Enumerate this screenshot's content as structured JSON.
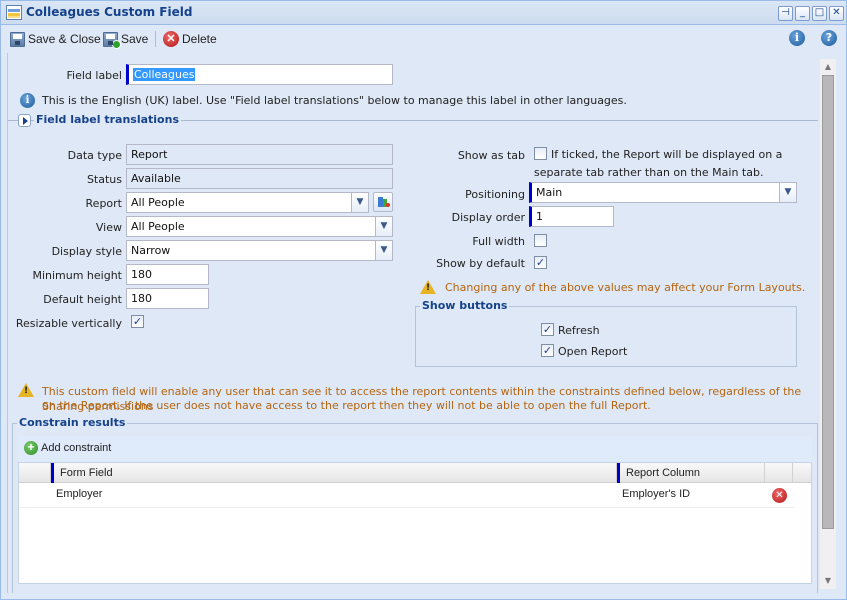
{
  "window": {
    "title": "Colleagues Custom Field",
    "controls": {
      "pin": "pin",
      "minimize": "minimize",
      "maximize": "maximize",
      "close": "close"
    }
  },
  "toolbar": {
    "save_close_label": "Save & Close",
    "save_label": "Save",
    "delete_label": "Delete"
  },
  "form": {
    "field_label": {
      "label": "Field label",
      "value": "Colleagues"
    },
    "info_note": "This is the English (UK) label. Use \"Field label translations\" below to manage this label in other languages.",
    "translations_title": "Field label translations",
    "data_type": {
      "label": "Data type",
      "value": "Report"
    },
    "status": {
      "label": "Status",
      "value": "Available"
    },
    "report": {
      "label": "Report",
      "value": "All People"
    },
    "view": {
      "label": "View",
      "value": "All People"
    },
    "display_style": {
      "label": "Display style",
      "value": "Narrow"
    },
    "min_height": {
      "label": "Minimum height",
      "value": "180"
    },
    "default_height": {
      "label": "Default height",
      "value": "180"
    },
    "resizable": {
      "label": "Resizable vertically",
      "checked": true
    },
    "show_as_tab": {
      "label": "Show as tab",
      "checked": false,
      "hint_line1": "If ticked, the Report will be displayed on a",
      "hint_line2": "separate tab rather than on the Main tab."
    },
    "positioning": {
      "label": "Positioning",
      "value": "Main"
    },
    "display_order": {
      "label": "Display order",
      "value": "1"
    },
    "full_width": {
      "label": "Full width",
      "checked": false
    },
    "show_by_default": {
      "label": "Show by default",
      "checked": true
    },
    "layout_warning": "Changing any of the above values may affect your Form Layouts.",
    "show_buttons": {
      "title": "Show buttons",
      "refresh": {
        "label": "Refresh",
        "checked": true
      },
      "open_report": {
        "label": "Open Report",
        "checked": true
      }
    },
    "access_warning_line1": "This custom field will enable any user that can see it to access the report contents within the constraints defined below, regardless of the Sharing permissions",
    "access_warning_line2": "on the Report. If the user does not have access to the report then they will not be able to open the full Report."
  },
  "constraints": {
    "title": "Constrain results",
    "add_label": "Add constraint",
    "columns": [
      "Form Field",
      "Report Column"
    ],
    "rows": [
      {
        "form_field": "Employer",
        "report_column": "Employer's ID"
      }
    ]
  },
  "colors": {
    "accent": "#15428b",
    "required_marker": "#0000cc",
    "warning_text": "#b4650f",
    "panel_bg": "#dfe8f6"
  }
}
